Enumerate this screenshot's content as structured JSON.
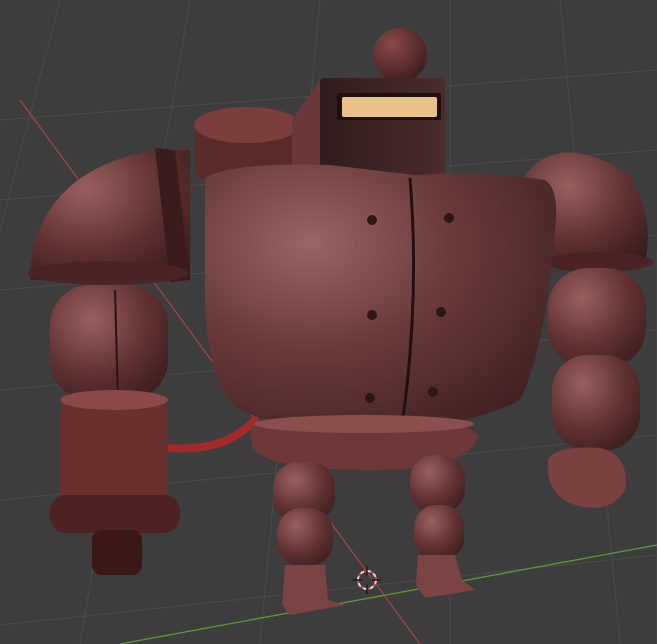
{
  "viewport": {
    "view_name": "",
    "background_color": "#3d3d3d",
    "grid_color": "#4a4a4a",
    "x_axis_color": "#b24848",
    "y_axis_color": "#6aa23a",
    "cursor_icon": "3d-cursor-icon"
  },
  "model": {
    "name": "",
    "material_color": "#6e3c3c",
    "visor_color": "#e9c287"
  }
}
